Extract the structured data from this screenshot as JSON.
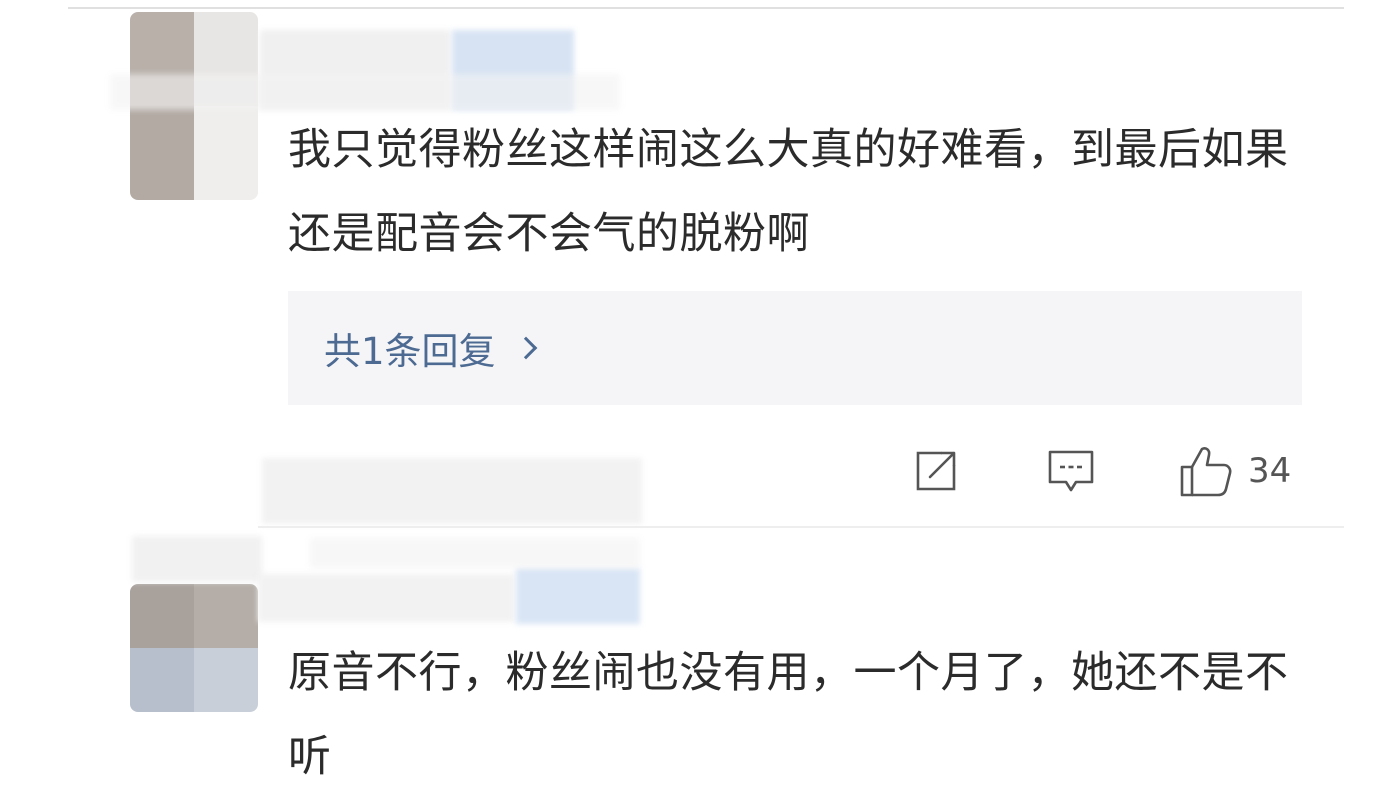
{
  "comments": [
    {
      "text": "我只觉得粉丝这样闹这么大真的好难看，到最后如果还是配音会不会气的脱粉啊",
      "reply_summary": "共1条回复",
      "like_count": "34"
    },
    {
      "text": "原音不行，粉丝闹也没有用，一个月了，她还不是不听"
    }
  ],
  "icons": {
    "repost": "repost-icon",
    "comment": "comment-icon",
    "like": "like-icon",
    "reply_chevron": "chevron-right-icon"
  },
  "colors": {
    "link": "#4c6a92",
    "reply_bg": "#f5f5f7",
    "icon": "#555555"
  }
}
